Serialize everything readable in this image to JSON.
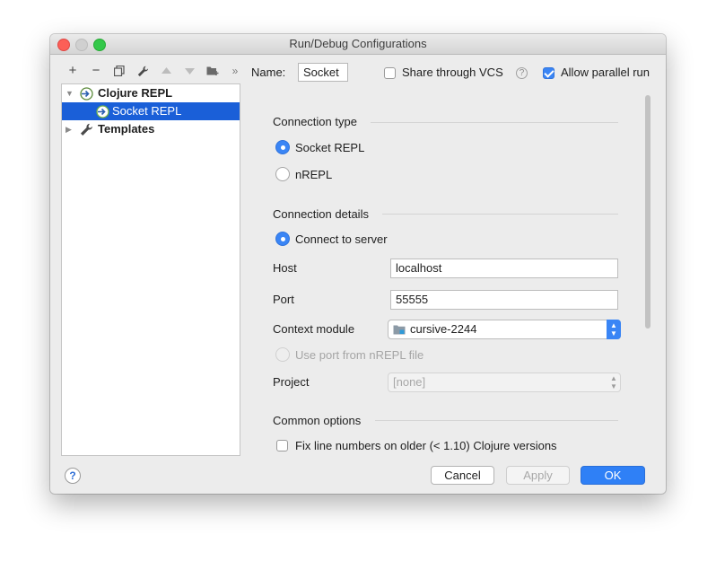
{
  "window": {
    "title": "Run/Debug Configurations"
  },
  "toolbar": {
    "add": "+",
    "remove": "−",
    "more": "»"
  },
  "tree": {
    "items": [
      {
        "label": "Clojure REPL",
        "icon": "clojure-repl-icon",
        "expanded": true
      },
      {
        "label": "Socket REPL",
        "icon": "clojure-repl-icon",
        "selected": true
      },
      {
        "label": "Templates",
        "icon": "wrench-icon",
        "expanded": false
      }
    ]
  },
  "header": {
    "name_label": "Name:",
    "name_value": "Socket",
    "share_label": "Share through VCS",
    "share_checked": false,
    "parallel_label": "Allow parallel run",
    "parallel_checked": true
  },
  "connection_type": {
    "title": "Connection type",
    "options": [
      {
        "label": "Socket REPL",
        "selected": true
      },
      {
        "label": "nREPL",
        "selected": false
      }
    ]
  },
  "connection_details": {
    "title": "Connection details",
    "connect_to_server": "Connect to server",
    "host_label": "Host",
    "host_value": "localhost",
    "port_label": "Port",
    "port_value": "55555",
    "context_module_label": "Context module",
    "context_module_value": "cursive-2244",
    "use_port_label": "Use port from nREPL file",
    "project_label": "Project",
    "project_value": "[none]"
  },
  "common_options": {
    "title": "Common options",
    "fix_line_numbers_label": "Fix line numbers on older (< 1.10) Clojure versions",
    "fix_line_numbers_checked": false
  },
  "footer": {
    "help": "?",
    "cancel": "Cancel",
    "apply": "Apply",
    "ok": "OK"
  },
  "colors": {
    "accent": "#2f80f6",
    "selection": "#1a5fd8"
  }
}
